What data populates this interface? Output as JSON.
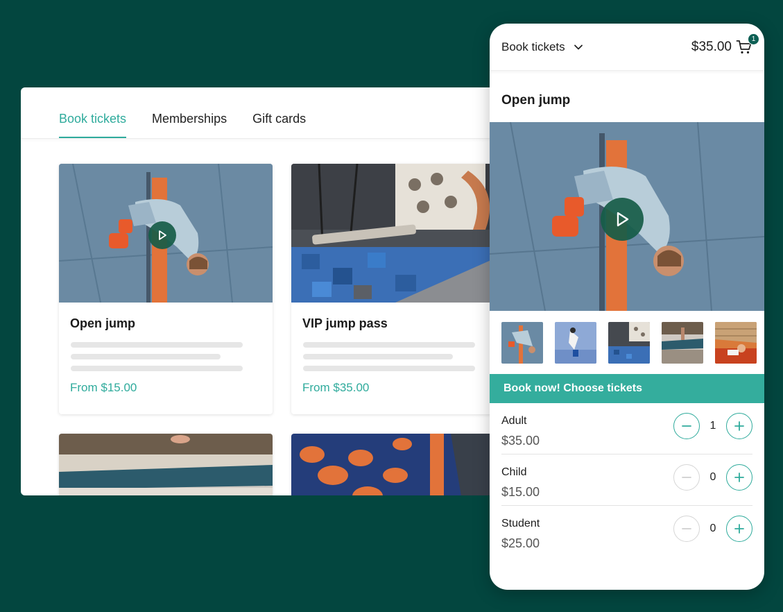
{
  "desktop": {
    "tabs": [
      {
        "label": "Book tickets",
        "active": true
      },
      {
        "label": "Memberships",
        "active": false
      },
      {
        "label": "Gift cards",
        "active": false
      }
    ],
    "cards": [
      {
        "title": "Open jump",
        "price": "From $15.00",
        "image": "jumper-photo",
        "video": true
      },
      {
        "title": "VIP jump pass",
        "price": "From $35.00",
        "image": "foam-pit-photo",
        "video": false
      }
    ]
  },
  "mobile": {
    "header": {
      "dropdown_label": "Book tickets",
      "cart_total": "$35.00",
      "cart_count": "1"
    },
    "product_title": "Open jump",
    "cta_label": "Book now! Choose tickets",
    "tickets": [
      {
        "name": "Adult",
        "price": "$35.00",
        "quantity": "1"
      },
      {
        "name": "Child",
        "price": "$15.00",
        "quantity": "0"
      },
      {
        "name": "Student",
        "price": "$25.00",
        "quantity": "0"
      }
    ]
  },
  "colors": {
    "background": "#03463f",
    "accent": "#2fab9c",
    "cta_bar": "#34ad9d",
    "play_button": "#165c48"
  }
}
